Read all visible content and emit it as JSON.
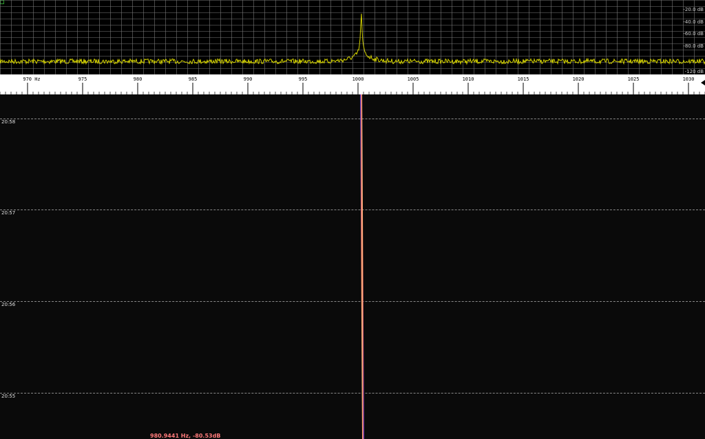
{
  "spectrum": {
    "db_labels": [
      "-20.0 dB",
      "-40.0 dB",
      "-60.0 dB",
      "-80.0 dB",
      "-120 dB"
    ],
    "trace_color": "#d6d400",
    "grid_color": "#7a7a7a",
    "peak_frequency_hz": 1000.3
  },
  "frequency_scale": {
    "labels": [
      "970 Hz",
      "975",
      "980",
      "985",
      "990",
      "995",
      "1000",
      "1005",
      "1010",
      "1015",
      "1020",
      "1025",
      "1030"
    ],
    "start_hz": 967.5,
    "end_hz": 1031.5
  },
  "waterfall": {
    "time_labels": [
      "20:58",
      "20:57",
      "20:56",
      "20:55"
    ],
    "signal_frequency_hz": 1000.3,
    "signal_color": "#ffe9a0"
  },
  "status": {
    "cursor_readout": "980.9441 Hz, -80.53dB"
  }
}
